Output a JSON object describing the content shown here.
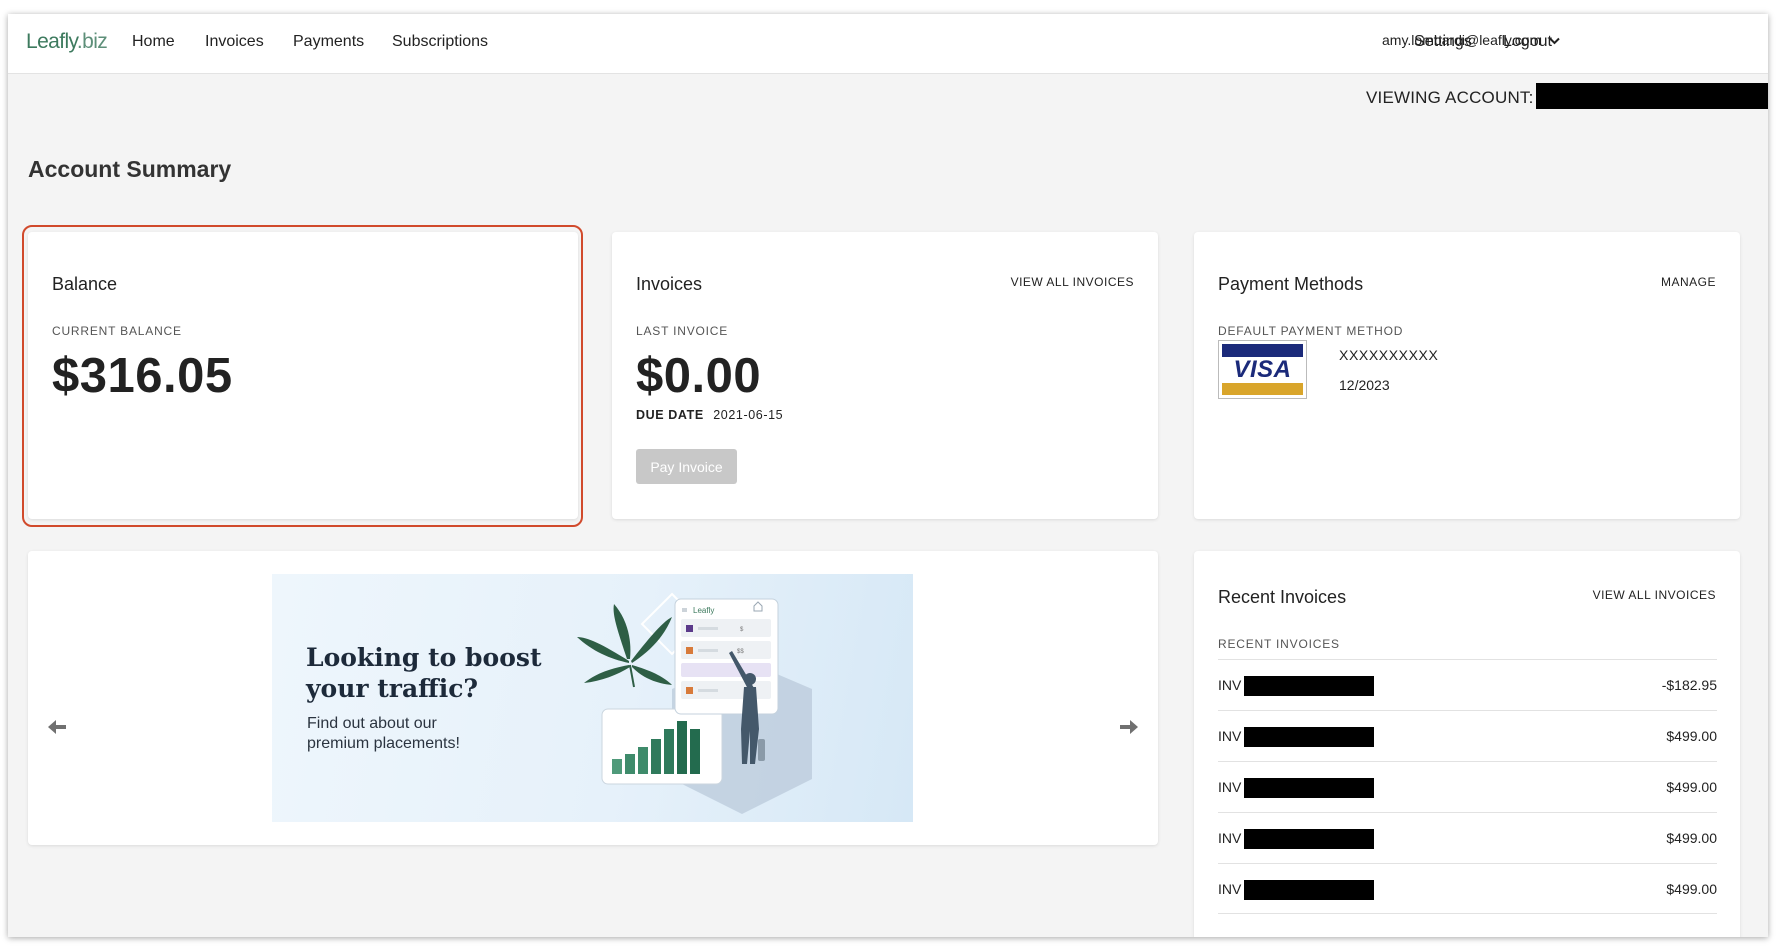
{
  "header": {
    "logo_main": "Leafly",
    "logo_suffix": ".biz",
    "nav": [
      "Home",
      "Invoices",
      "Payments",
      "Subscriptions"
    ],
    "user_email": "amy.lombardi@leafly.com",
    "settings_label": "Settings",
    "logout_label": "Logout"
  },
  "viewing_account_label": "VIEWING ACCOUNT:",
  "page_title": "Account Summary",
  "balance": {
    "title": "Balance",
    "label": "CURRENT BALANCE",
    "amount": "$316.05"
  },
  "invoices": {
    "title": "Invoices",
    "link": "VIEW ALL INVOICES",
    "label": "LAST INVOICE",
    "amount": "$0.00",
    "due_label": "DUE DATE",
    "due_date": "2021-06-15",
    "pay_button": "Pay Invoice"
  },
  "payment_methods": {
    "title": "Payment Methods",
    "link": "MANAGE",
    "label": "DEFAULT PAYMENT METHOD",
    "card_brand": "VISA",
    "card_number": "XXXXXXXXXX",
    "card_expiry": "12/2023"
  },
  "promo": {
    "headline_line1": "Looking to boost",
    "headline_line2": "your traffic?",
    "subtext_line1": "Find out about our",
    "subtext_line2": "premium placements!",
    "mockup_brand": "Leafly",
    "mockup_price1": "$",
    "mockup_price2": "$$"
  },
  "recent_invoices": {
    "title": "Recent Invoices",
    "link": "VIEW ALL INVOICES",
    "label": "RECENT INVOICES",
    "rows": [
      {
        "prefix": "INV",
        "amount": "-$182.95"
      },
      {
        "prefix": "INV",
        "amount": "$499.00"
      },
      {
        "prefix": "INV",
        "amount": "$499.00"
      },
      {
        "prefix": "INV",
        "amount": "$499.00"
      },
      {
        "prefix": "INV",
        "amount": "$499.00"
      }
    ]
  },
  "colors": {
    "brand_green": "#3d7a5e",
    "highlight_border": "#d14a2c",
    "disabled_button": "#c8c8c8",
    "visa_blue": "#1b2a7a",
    "visa_gold": "#d9a52b"
  },
  "icons": [
    "chevron-down-icon",
    "arrow-left-icon",
    "arrow-right-icon",
    "cannabis-leaf-icon",
    "bar-chart-icon",
    "home-icon",
    "menu-icon"
  ]
}
